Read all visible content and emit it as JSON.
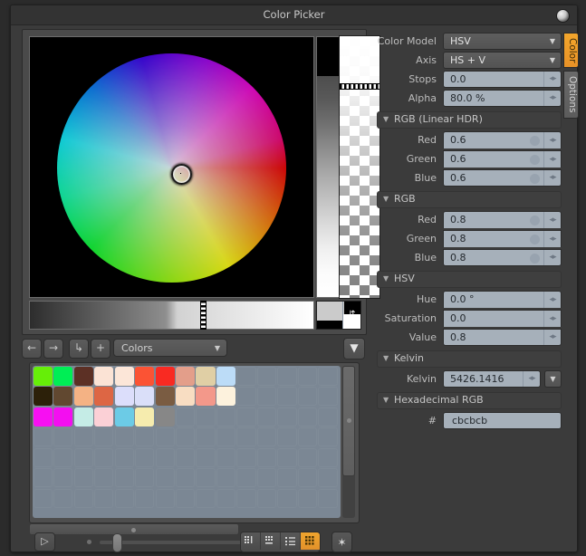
{
  "window": {
    "title": "Color Picker",
    "corner_icon": "sphere-icon"
  },
  "tabs": [
    {
      "label": "Color",
      "active": true
    },
    {
      "label": "Options",
      "active": false
    }
  ],
  "wheel": {
    "name": "color-wheel",
    "cursor_x_pct": 53,
    "cursor_y_pct": 52,
    "value_strip": "value-gradient-strip",
    "alpha_strip": "alpha-checker-strip",
    "alpha_marker_pct": 18,
    "gray_ramp": "gray-ramp-strip",
    "gray_marker_pct": 60
  },
  "fields": {
    "color_model": {
      "label": "Color Model",
      "value": "HSV"
    },
    "axis": {
      "label": "Axis",
      "value": "HS + V"
    },
    "stops": {
      "label": "Stops",
      "value": "0.0"
    },
    "alpha": {
      "label": "Alpha",
      "value": "80.0 %"
    }
  },
  "sections": {
    "rgb_linear_hdr": {
      "title": "RGB (Linear HDR)",
      "rows": [
        {
          "label": "Red",
          "value": "0.6"
        },
        {
          "label": "Green",
          "value": "0.6"
        },
        {
          "label": "Blue",
          "value": "0.6"
        }
      ]
    },
    "rgb": {
      "title": "RGB",
      "rows": [
        {
          "label": "Red",
          "value": "0.8"
        },
        {
          "label": "Green",
          "value": "0.8"
        },
        {
          "label": "Blue",
          "value": "0.8"
        }
      ]
    },
    "hsv": {
      "title": "HSV",
      "rows": [
        {
          "label": "Hue",
          "value": "0.0 °"
        },
        {
          "label": "Saturation",
          "value": "0.0"
        },
        {
          "label": "Value",
          "value": "0.8"
        }
      ]
    },
    "kelvin": {
      "title": "Kelvin",
      "rows": [
        {
          "label": "Kelvin",
          "value": "5426.1416"
        }
      ]
    },
    "hexadecimal_rgb": {
      "title": "Hexadecimal RGB",
      "hash_label": "#",
      "value": "cbcbcb"
    }
  },
  "palette_toolbar": {
    "back": "back-arrow-icon",
    "forward": "forward-arrow-icon",
    "up": "up-level-icon",
    "add": "add-icon",
    "dropdown_value": "Colors",
    "filter": "filter-icon"
  },
  "swatch_grid": {
    "columns": 15,
    "rows": 7,
    "empty_color": "#7b8794",
    "colors": [
      [
        "#66ee08",
        "#00ee55",
        "#5c3025",
        "#fbe3d5",
        "#fce6d8",
        "#fb5334",
        "#f92a22",
        "#e39e8a",
        "#e0cfa5",
        "#bcdcf7",
        null,
        null,
        null,
        null,
        null
      ],
      [
        "#2c2009",
        "#614830",
        "#f4b284",
        "#dd6644",
        "#dcdefb",
        "#dadff9",
        "#7a5c42",
        "#f8ddc2",
        "#f3988a",
        "#fdf2dd",
        null,
        null,
        null,
        null,
        null
      ],
      [
        "#f70ff2",
        "#f30ef0",
        "#c5ece6",
        "#fbd0d6",
        "#6ccbe6",
        "#f6ecae",
        "#878787",
        null,
        null,
        null,
        null,
        null,
        null,
        null,
        null
      ],
      [
        null,
        null,
        null,
        null,
        null,
        null,
        null,
        null,
        null,
        null,
        null,
        null,
        null,
        null,
        null
      ],
      [
        null,
        null,
        null,
        null,
        null,
        null,
        null,
        null,
        null,
        null,
        null,
        null,
        null,
        null,
        null
      ],
      [
        null,
        null,
        null,
        null,
        null,
        null,
        null,
        null,
        null,
        null,
        null,
        null,
        null,
        null,
        null
      ],
      [
        null,
        null,
        null,
        null,
        null,
        null,
        null,
        null,
        null,
        null,
        null,
        null,
        null,
        null,
        null
      ]
    ]
  },
  "bottom_bar": {
    "sidebar_toggle": "panel-toggle-icon",
    "zoom_slider_pct": 8,
    "view_modes": [
      {
        "name": "detail-view-icon",
        "active": false
      },
      {
        "name": "list-view-icon",
        "active": false
      },
      {
        "name": "compact-list-icon",
        "active": false
      },
      {
        "name": "grid-view-icon",
        "active": true
      }
    ],
    "settings": "gear-icon"
  },
  "colors": {
    "accent": "#f0a52e",
    "panel_bg": "#3b3b3b",
    "field_bg": "#a6b0ba",
    "current_color": "#cbcbcb"
  }
}
